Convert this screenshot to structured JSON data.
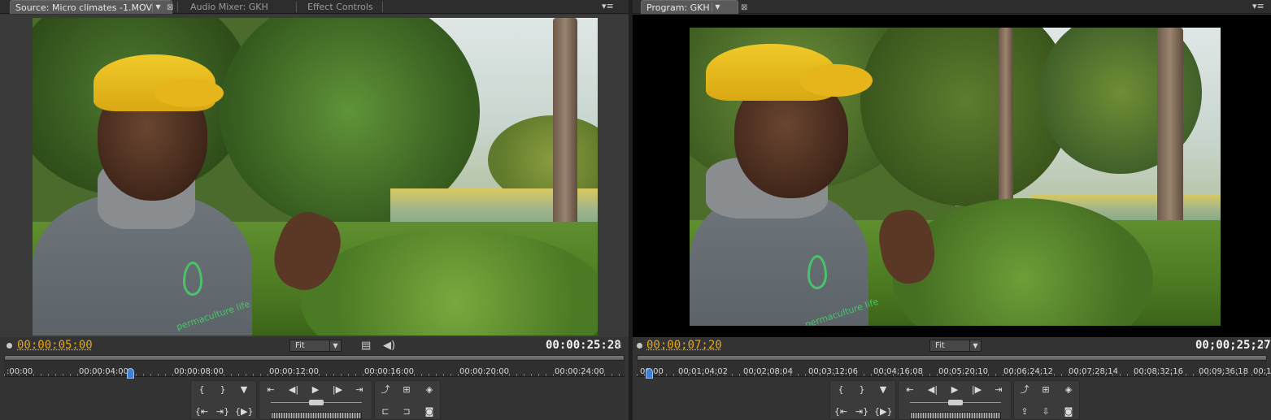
{
  "source_panel": {
    "tabs": [
      {
        "label": "Source: Micro climates -1.MOV",
        "active": true
      },
      {
        "label": "Audio Mixer: GKH",
        "active": false
      },
      {
        "label": "Effect Controls",
        "active": false
      }
    ],
    "tab_dropdown_glyph": "▼",
    "tab_close_glyph": "⊠",
    "panel_menu_glyph": "▾≡",
    "current_timecode": "00:00:05:00",
    "duration_timecode": "00:00:25:28",
    "fit_label": "Fit",
    "dropdown_glyph": "▼",
    "clip_icon": "filmstrip-icon",
    "audio_icon": "speaker-icon",
    "ruler_labels": [
      ":00:00",
      "00:00:04:00",
      "00:00:08:00",
      "00:00:12:00",
      "00:00:16:00",
      "00:00:20:00",
      "00:00:24:00"
    ],
    "playhead_position": 0.198
  },
  "program_panel": {
    "tabs": [
      {
        "label": "Program: GKH",
        "active": true
      }
    ],
    "tab_dropdown_glyph": "▼",
    "tab_close_glyph": "⊠",
    "panel_menu_glyph": "▾≡",
    "current_timecode": "00;00;07;20",
    "duration_timecode": "00;00;25;27",
    "fit_label": "Fit",
    "dropdown_glyph": "▼",
    "ruler_labels": [
      "00;00",
      "00;01;04;02",
      "00;02;08;04",
      "00;03;12;06",
      "00;04;16;08",
      "00;05;20;10",
      "00;06;24;12",
      "00;07;28;14",
      "00;08;32;16",
      "00;09;36;18",
      "00;1"
    ],
    "playhead_position": 0.014
  },
  "transport": {
    "mark_in": "{",
    "mark_out": "}",
    "marker": "▼",
    "step_back_edit": "⇤",
    "step_back": "◀|",
    "play": "▶",
    "step_forward": "|▶",
    "step_forward_edit": "⇥",
    "loop": "⤴",
    "safe_margins": "⊞",
    "output": "◈",
    "go_to_in": "{⇤",
    "go_to_out": "⇥}",
    "play_in_out": "{▶}",
    "insert": "⊏",
    "overlay": "⊐",
    "export_frame": "📷",
    "lift": "⇪",
    "extract": "⇩"
  },
  "colors": {
    "timecode_current": "#e8a80e",
    "timecode_duration": "#f2f2f2",
    "playhead": "#3e7fd8",
    "panel_bg": "#333333"
  }
}
